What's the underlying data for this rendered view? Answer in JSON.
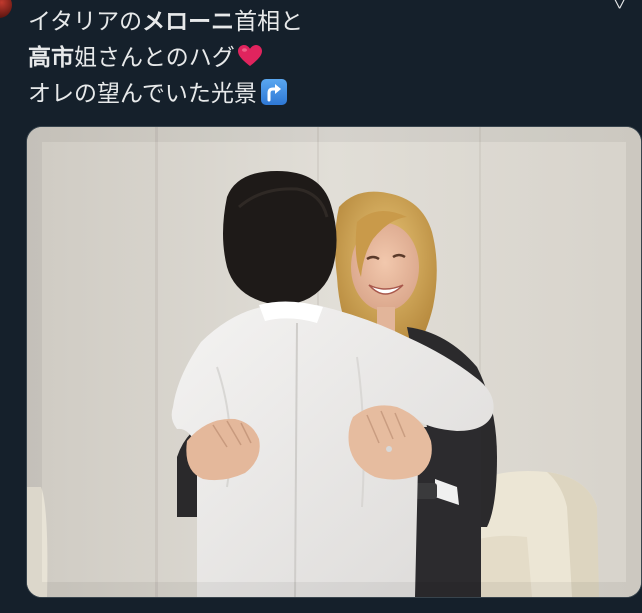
{
  "tweet": {
    "line1_prefix": "イタリアの",
    "line1_bold": "メローニ",
    "line1_suffix": "首相と",
    "line2_bold": "高市",
    "line2_suffix": "姐さんとのハグ",
    "line3": "オレの望んでいた光景",
    "heart_emoji": "heart-icon",
    "arrow_emoji": "arrow-up-right-icon"
  },
  "colors": {
    "background": "#15202b",
    "text": "#e7e9ea",
    "heart": "#e0245e",
    "arrow_emoji_bg": "#3b8ae4"
  },
  "photo": {
    "alt": "Two women embracing in a hug in a beige room"
  }
}
